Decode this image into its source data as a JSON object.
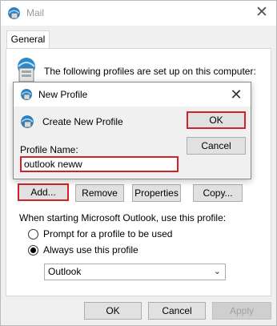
{
  "window": {
    "title": "Mail",
    "close_label": "✕"
  },
  "tabs": [
    {
      "label": "General"
    }
  ],
  "general": {
    "profiles_text": "The following profiles are set up on this computer:",
    "buttons": {
      "add": "Add...",
      "remove": "Remove",
      "properties": "Properties",
      "copy": "Copy..."
    },
    "startup_label": "When starting Microsoft Outlook, use this profile:",
    "radio_prompt": "Prompt for a profile to be used",
    "radio_always": "Always use this profile",
    "selected_profile": "Outlook"
  },
  "footer": {
    "ok": "OK",
    "cancel": "Cancel",
    "apply": "Apply"
  },
  "dialog": {
    "title": "New Profile",
    "close_label": "✕",
    "create_text": "Create New Profile",
    "name_label": "Profile Name:",
    "name_value": "outlook neww",
    "ok": "OK",
    "cancel": "Cancel"
  },
  "colors": {
    "highlight": "#d1222c",
    "panel": "#ffffff",
    "window": "#f0f0f0"
  },
  "icons": {
    "app": "mail-globe-icon",
    "profiles": "profiles-computer-icon",
    "dialog": "mail-globe-icon",
    "dropdown": "chevron-down-icon"
  }
}
